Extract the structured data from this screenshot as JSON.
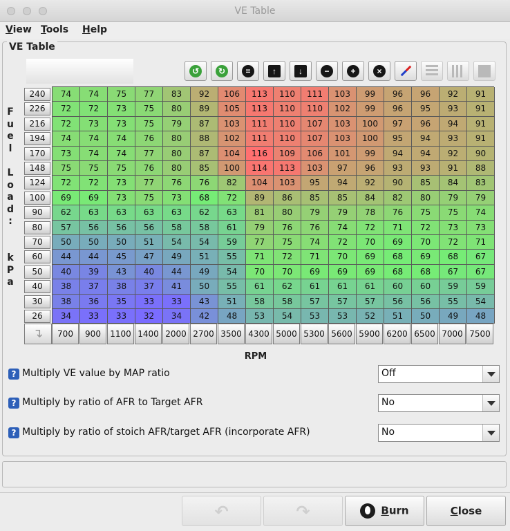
{
  "window": {
    "title": "VE Table"
  },
  "menubar": {
    "items": [
      {
        "label": "View",
        "underline": "V",
        "rest": "iew"
      },
      {
        "label": "Tools",
        "underline": "T",
        "rest": "ools"
      },
      {
        "label": "Help",
        "underline": "H",
        "rest": "elp"
      }
    ]
  },
  "panel": {
    "title": "VE Table"
  },
  "toolbar": {
    "buttons": [
      {
        "icon": "green-rotate-left-icon"
      },
      {
        "icon": "green-rotate-right-icon"
      },
      {
        "icon": "equals-icon"
      },
      {
        "icon": "arrow-up-icon"
      },
      {
        "icon": "arrow-down-icon"
      },
      {
        "icon": "minus-icon"
      },
      {
        "icon": "plus-icon"
      },
      {
        "icon": "multiply-icon"
      },
      {
        "icon": "pencil-icon"
      },
      {
        "icon": "horizontal-lines-icon"
      },
      {
        "icon": "vertical-lines-icon"
      },
      {
        "icon": "fill-square-icon"
      }
    ]
  },
  "y_axis": {
    "letters": [
      "F",
      "u",
      "e",
      "l",
      "",
      "L",
      "o",
      "a",
      "d",
      ":",
      "",
      "k",
      "P",
      "a"
    ]
  },
  "x_axis": {
    "title": "RPM"
  },
  "table": {
    "rpm": [
      700,
      900,
      1100,
      1400,
      2000,
      2700,
      3500,
      4300,
      5000,
      5300,
      5600,
      5900,
      6200,
      6500,
      7000,
      7500
    ],
    "load": [
      240,
      226,
      216,
      194,
      170,
      148,
      124,
      100,
      90,
      80,
      70,
      60,
      50,
      40,
      30,
      26
    ],
    "ve": [
      [
        74,
        74,
        75,
        77,
        83,
        92,
        106,
        113,
        110,
        111,
        103,
        99,
        96,
        96,
        92,
        91
      ],
      [
        72,
        72,
        73,
        75,
        80,
        89,
        105,
        113,
        110,
        110,
        102,
        99,
        96,
        95,
        93,
        91
      ],
      [
        72,
        73,
        73,
        75,
        79,
        87,
        103,
        111,
        110,
        107,
        103,
        100,
        97,
        96,
        94,
        91
      ],
      [
        74,
        74,
        74,
        76,
        80,
        88,
        102,
        111,
        110,
        107,
        103,
        100,
        95,
        94,
        93,
        91
      ],
      [
        73,
        74,
        74,
        77,
        80,
        87,
        104,
        116,
        109,
        106,
        101,
        99,
        94,
        94,
        92,
        90
      ],
      [
        75,
        75,
        75,
        76,
        80,
        85,
        100,
        114,
        113,
        103,
        97,
        96,
        93,
        93,
        91,
        88
      ],
      [
        72,
        72,
        73,
        77,
        76,
        76,
        82,
        104,
        103,
        95,
        94,
        92,
        90,
        85,
        84,
        83
      ],
      [
        69,
        69,
        73,
        75,
        73,
        68,
        72,
        89,
        86,
        85,
        85,
        84,
        82,
        80,
        79,
        79
      ],
      [
        62,
        63,
        63,
        63,
        63,
        62,
        63,
        81,
        80,
        79,
        79,
        78,
        76,
        75,
        75,
        74
      ],
      [
        57,
        56,
        56,
        56,
        58,
        58,
        61,
        79,
        76,
        76,
        74,
        72,
        71,
        72,
        73,
        73
      ],
      [
        50,
        50,
        50,
        51,
        54,
        54,
        59,
        77,
        75,
        74,
        72,
        70,
        69,
        70,
        72,
        71
      ],
      [
        44,
        44,
        45,
        47,
        49,
        51,
        55,
        71,
        72,
        71,
        70,
        69,
        68,
        69,
        68,
        67
      ],
      [
        40,
        39,
        43,
        40,
        44,
        49,
        54,
        70,
        70,
        69,
        69,
        69,
        68,
        68,
        67,
        67
      ],
      [
        38,
        37,
        38,
        37,
        41,
        50,
        55,
        61,
        62,
        61,
        61,
        61,
        60,
        60,
        59,
        59
      ],
      [
        38,
        36,
        35,
        33,
        33,
        43,
        51,
        58,
        58,
        57,
        57,
        57,
        56,
        56,
        55,
        54
      ],
      [
        34,
        33,
        33,
        32,
        34,
        42,
        48,
        53,
        54,
        53,
        53,
        52,
        51,
        50,
        49,
        48
      ]
    ]
  },
  "options": [
    {
      "label": "Multiply VE value by MAP ratio",
      "value": "Off"
    },
    {
      "label": "Multiply by ratio of AFR to Target AFR",
      "value": "No"
    },
    {
      "label": "Multiply by ratio of stoich AFR/target AFR (incorporate AFR)",
      "value": "No"
    }
  ],
  "buttons": {
    "burn": {
      "underline": "B",
      "rest": "urn"
    },
    "close": {
      "underline": "C",
      "rest": "lose"
    }
  },
  "colors": {
    "low": "#7a6cff",
    "mid": "#76ec76",
    "high": "#ff7070"
  }
}
